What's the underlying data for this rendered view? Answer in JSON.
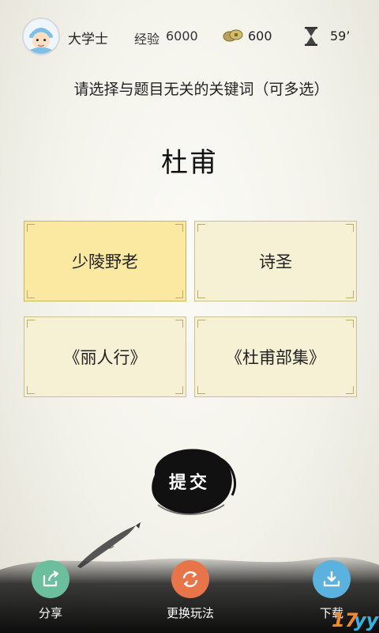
{
  "header": {
    "rank": "大学士",
    "exp_label": "经验",
    "exp_value": "6000",
    "coins": "600",
    "timer": "59’"
  },
  "instruction": "请选择与题目无关的关键词（可多选）",
  "keyword": "杜甫",
  "options": [
    {
      "label": "少陵野老",
      "selected": true
    },
    {
      "label": "诗圣",
      "selected": false
    },
    {
      "label": "《丽人行》",
      "selected": false
    },
    {
      "label": "《杜甫部集》",
      "selected": false
    }
  ],
  "submit_label": "提交",
  "bottom_bar": {
    "share": "分享",
    "switch": "更换玩法",
    "download": "下载"
  },
  "watermark": "17yy",
  "colors": {
    "card_bg": "#f6f0d4",
    "card_selected_bg": "#fbe9a1",
    "share_green": "#6bbf9c",
    "switch_orange": "#e8744a",
    "download_blue": "#5bb2de"
  }
}
